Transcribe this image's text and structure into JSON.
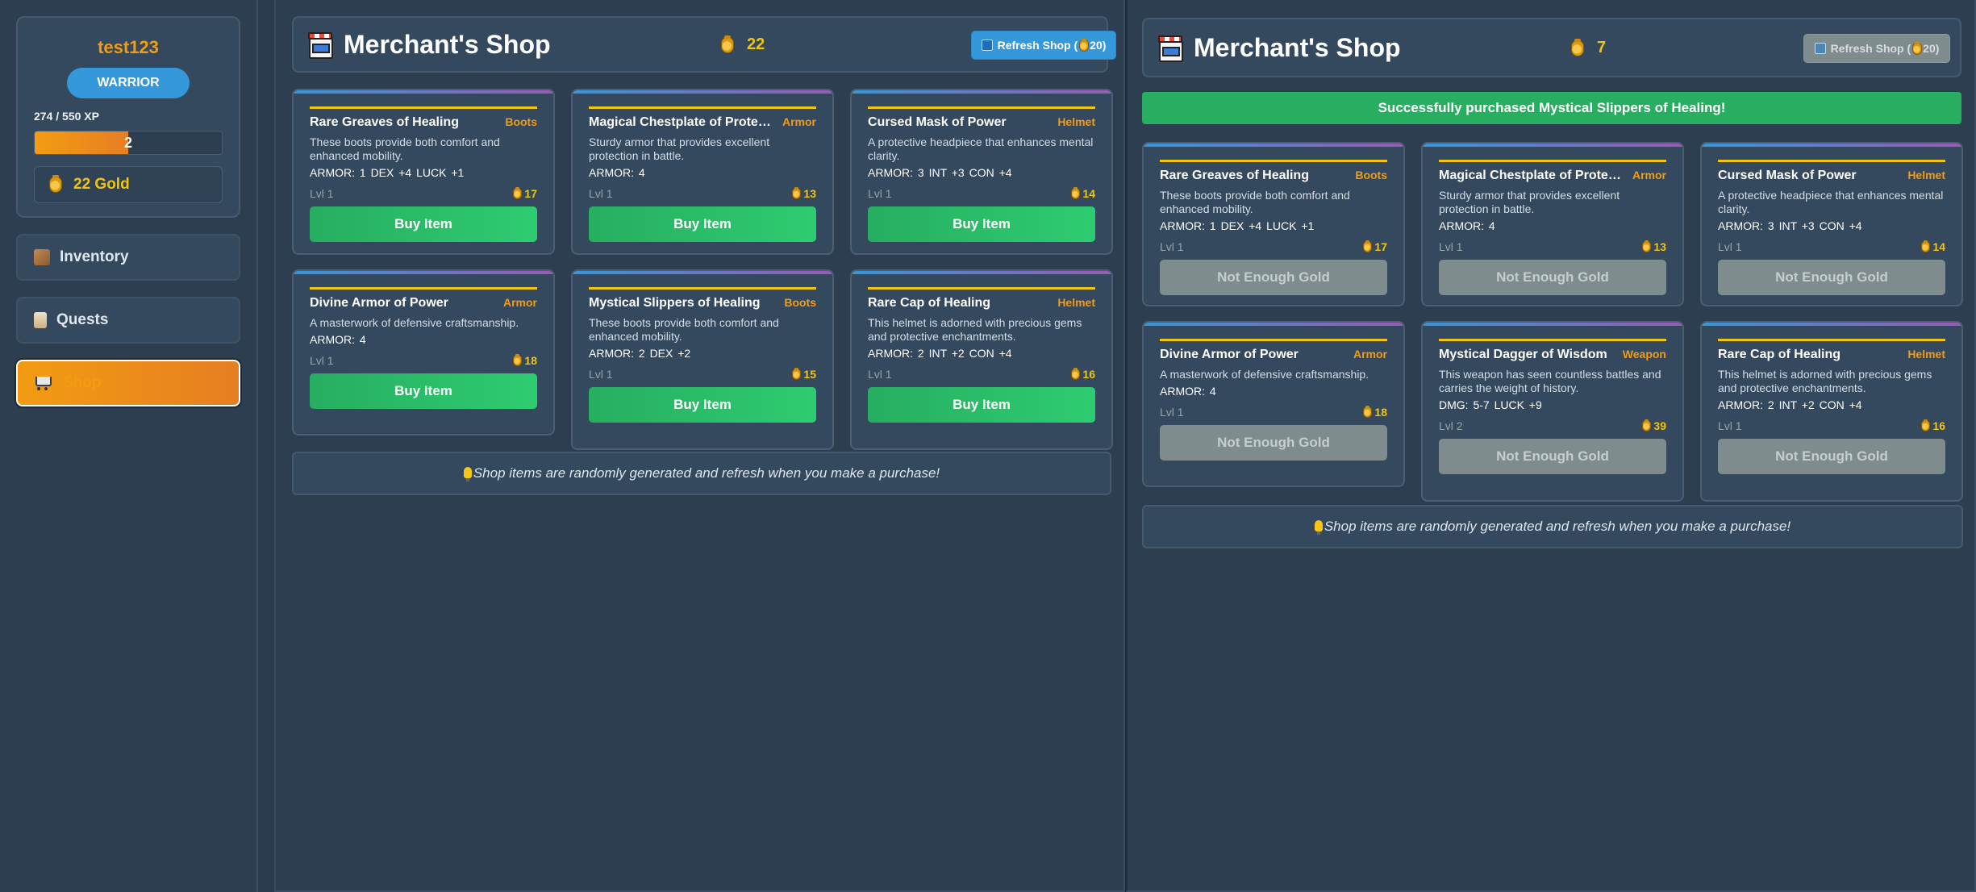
{
  "player": {
    "name": "test123",
    "class": "WARRIOR",
    "xp_text": "274 / 550 XP",
    "xp_fraction": 0.498,
    "level": "2",
    "gold_text": "22 Gold"
  },
  "nav": {
    "inventory": "Inventory",
    "quests": "Quests",
    "shop": "Shop"
  },
  "left_shop": {
    "title": "Merchant's Shop",
    "gold": "22",
    "refresh_label": "Refresh Shop (",
    "refresh_cost": "20)",
    "items": [
      {
        "name": "Rare Greaves of Healing",
        "type": "Boots",
        "desc": "These boots provide both comfort and enhanced mobility.",
        "stats": "ARMOR: 1  DEX +4  LUCK +1",
        "level": "Lvl 1",
        "price": "17",
        "button": "Buy Item"
      },
      {
        "name": "Magical Chestplate of Protecti...",
        "type": "Armor",
        "desc": "Sturdy armor that provides excellent protection in battle.",
        "stats": "ARMOR: 4",
        "level": "Lvl 1",
        "price": "13",
        "button": "Buy Item"
      },
      {
        "name": "Cursed Mask of Power",
        "type": "Helmet",
        "desc": "A protective headpiece that enhances mental clarity.",
        "stats": "ARMOR: 3  INT +3  CON +4",
        "level": "Lvl 1",
        "price": "14",
        "button": "Buy Item"
      },
      {
        "name": "Divine Armor of Power",
        "type": "Armor",
        "desc": "A masterwork of defensive craftsmanship.",
        "stats": "ARMOR: 4",
        "level": "Lvl 1",
        "price": "18",
        "button": "Buy Item"
      },
      {
        "name": "Mystical Slippers of Healing",
        "type": "Boots",
        "desc": "These boots provide both comfort and enhanced mobility.",
        "stats": "ARMOR: 2  DEX +2",
        "level": "Lvl 1",
        "price": "15",
        "button": "Buy Item"
      },
      {
        "name": "Rare Cap of Healing",
        "type": "Helmet",
        "desc": "This helmet is adorned with precious gems and protective enchantments.",
        "stats": "ARMOR: 2  INT +2  CON +4",
        "level": "Lvl 1",
        "price": "16",
        "button": "Buy Item"
      }
    ],
    "info": "Shop items are randomly generated and refresh when you make a purchase!"
  },
  "right_shop": {
    "title": "Merchant's Shop",
    "gold": "7",
    "refresh_label": "Refresh Shop (",
    "refresh_cost": "20)",
    "banner": "Successfully purchased Mystical Slippers of Healing!",
    "items": [
      {
        "name": "Rare Greaves of Healing",
        "type": "Boots",
        "desc": "These boots provide both comfort and enhanced mobility.",
        "stats": "ARMOR: 1  DEX +4  LUCK +1",
        "level": "Lvl 1",
        "price": "17",
        "button": "Not Enough Gold"
      },
      {
        "name": "Magical Chestplate of Protecti...",
        "type": "Armor",
        "desc": "Sturdy armor that provides excellent protection in battle.",
        "stats": "ARMOR: 4",
        "level": "Lvl 1",
        "price": "13",
        "button": "Not Enough Gold"
      },
      {
        "name": "Cursed Mask of Power",
        "type": "Helmet",
        "desc": "A protective headpiece that enhances mental clarity.",
        "stats": "ARMOR: 3  INT +3  CON +4",
        "level": "Lvl 1",
        "price": "14",
        "button": "Not Enough Gold"
      },
      {
        "name": "Divine Armor of Power",
        "type": "Armor",
        "desc": "A masterwork of defensive craftsmanship.",
        "stats": "ARMOR: 4",
        "level": "Lvl 1",
        "price": "18",
        "button": "Not Enough Gold"
      },
      {
        "name": "Mystical Dagger of Wisdom",
        "type": "Weapon",
        "desc": "This weapon has seen countless battles and carries the weight of history.",
        "stats": "DMG: 5-7  LUCK +9",
        "level": "Lvl 2",
        "price": "39",
        "button": "Not Enough Gold"
      },
      {
        "name": "Rare Cap of Healing",
        "type": "Helmet",
        "desc": "This helmet is adorned with precious gems and protective enchantments.",
        "stats": "ARMOR: 2  INT +2  CON +4",
        "level": "Lvl 1",
        "price": "16",
        "button": "Not Enough Gold"
      }
    ],
    "info": "Shop items are randomly generated and refresh when you make a purchase!"
  },
  "colors": {
    "accent": "#f39c12",
    "gold": "#f1c40f",
    "buy": "#2ecc71",
    "disabled": "#7f8c8d",
    "refresh": "#3498db"
  }
}
